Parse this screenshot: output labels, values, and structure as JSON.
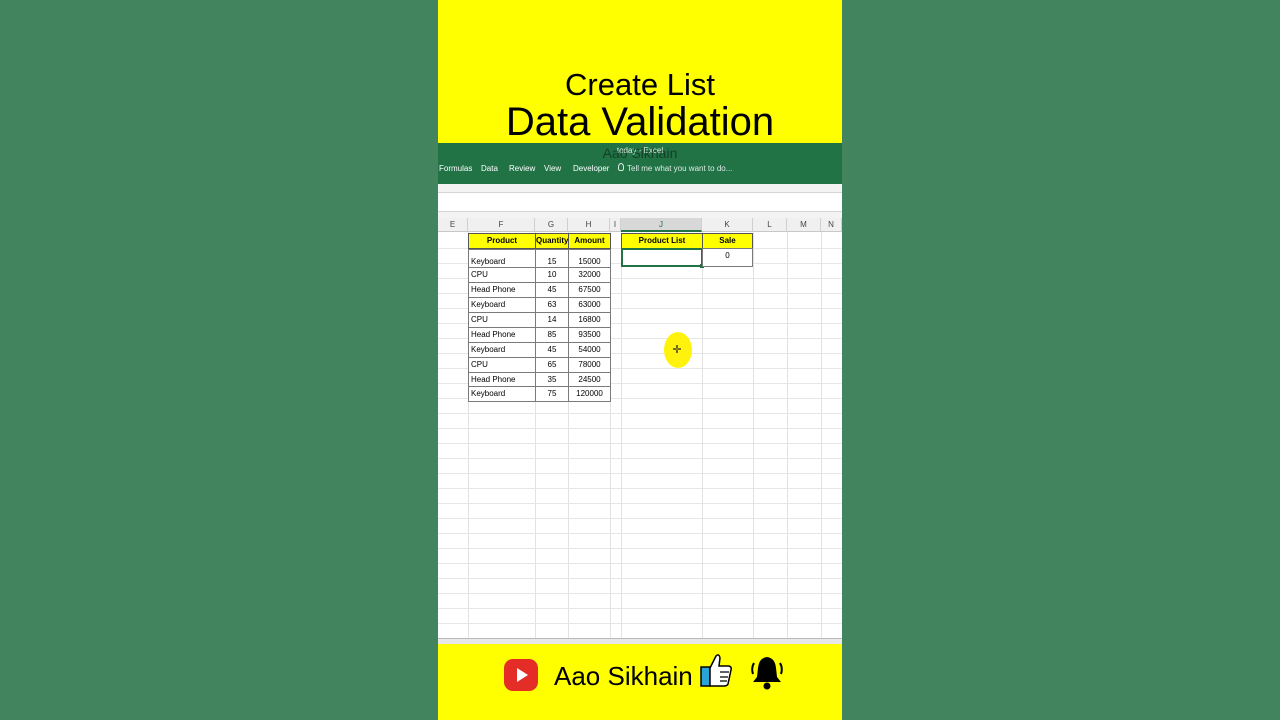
{
  "banner": {
    "title_line1": "Create List",
    "title_line2": "Data Validation"
  },
  "ribbon": {
    "window_title": "today - Excel",
    "watermark": "Aao Sikhain",
    "tabs": [
      "Formulas",
      "Data",
      "Review",
      "View",
      "Developer"
    ],
    "tell_me": "Tell me what you want to do..."
  },
  "sheet": {
    "column_headers": [
      "E",
      "F",
      "G",
      "H",
      "I",
      "J",
      "K",
      "L",
      "M",
      "N"
    ],
    "table": {
      "headers": [
        "Product",
        "Quantity",
        "Amount"
      ],
      "rows": [
        [
          "Keyboard",
          "15",
          "15000"
        ],
        [
          "CPU",
          "10",
          "32000"
        ],
        [
          "Head Phone",
          "45",
          "67500"
        ],
        [
          "Keyboard",
          "63",
          "63000"
        ],
        [
          "CPU",
          "14",
          "16800"
        ],
        [
          "Head Phone",
          "85",
          "93500"
        ],
        [
          "Keyboard",
          "45",
          "54000"
        ],
        [
          "CPU",
          "65",
          "78000"
        ],
        [
          "Head Phone",
          "35",
          "24500"
        ],
        [
          "Keyboard",
          "75",
          "120000"
        ]
      ]
    },
    "lookup": {
      "product_list_header": "Product List",
      "sale_header": "Sale",
      "product_list_value": "",
      "sale_value": "0"
    }
  },
  "footer": {
    "channel_name": "Aao Sikhain"
  },
  "colors": {
    "excel_green": "#217346",
    "banner_yellow": "#ffff00",
    "youtube_red": "#e52d27"
  }
}
